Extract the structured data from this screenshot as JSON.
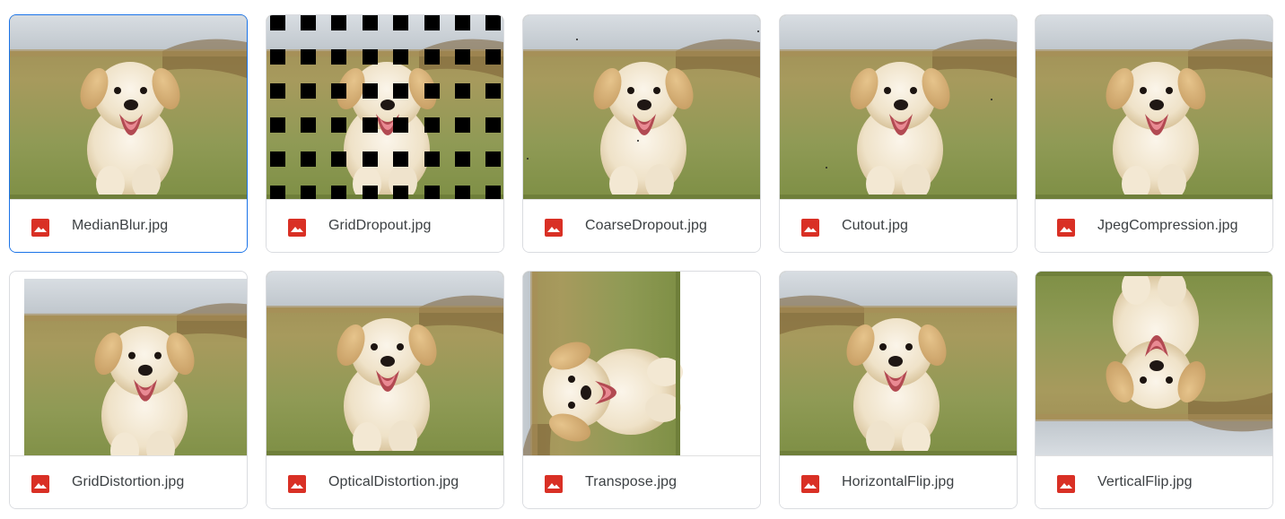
{
  "files": [
    {
      "name": "MedianBlur.jpg",
      "effect": "none",
      "selected": true
    },
    {
      "name": "GridDropout.jpg",
      "effect": "grid-dropout",
      "selected": false
    },
    {
      "name": "CoarseDropout.jpg",
      "effect": "coarse-dropout",
      "selected": false
    },
    {
      "name": "Cutout.jpg",
      "effect": "cutout",
      "selected": false
    },
    {
      "name": "JpegCompression.jpg",
      "effect": "none",
      "selected": false
    },
    {
      "name": "GridDistortion.jpg",
      "effect": "grid-distortion",
      "selected": false
    },
    {
      "name": "OpticalDistortion.jpg",
      "effect": "optical-distortion",
      "selected": false
    },
    {
      "name": "Transpose.jpg",
      "effect": "transpose",
      "selected": false
    },
    {
      "name": "HorizontalFlip.jpg",
      "effect": "horizontal-flip",
      "selected": false
    },
    {
      "name": "VerticalFlip.jpg",
      "effect": "vertical-flip",
      "selected": false
    }
  ],
  "file_icon": "image-file-icon",
  "colors": {
    "accent": "#1a73e8",
    "icon_red": "#d93025",
    "text": "#3c4043",
    "border": "#dadce0"
  }
}
